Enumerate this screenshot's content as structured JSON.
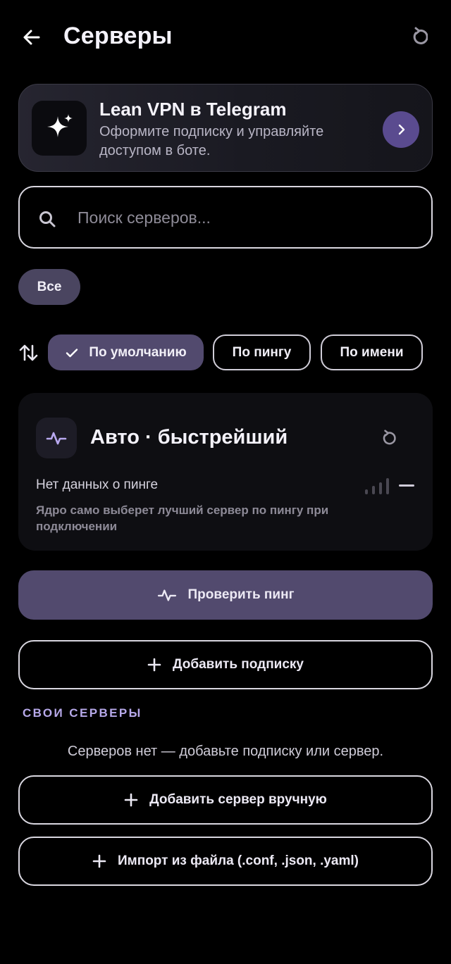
{
  "header": {
    "title": "Серверы",
    "back_icon": "arrow-left-icon",
    "refresh_icon": "refresh-icon"
  },
  "promo": {
    "title": "Lean VPN в Telegram",
    "subtitle": "Оформите подписку и управляйте доступом в боте.",
    "icon": "sparkle-icon",
    "arrow_icon": "chevron-right-icon",
    "accent_color": "#5a4b8f"
  },
  "search": {
    "placeholder": "Поиск серверов...",
    "value": ""
  },
  "filters": {
    "all_label": "Все"
  },
  "sort": {
    "options": [
      {
        "label": "По умолчанию",
        "selected": true
      },
      {
        "label": "По пингу",
        "selected": false
      },
      {
        "label": "По имени",
        "selected": false
      }
    ]
  },
  "auto": {
    "title": "Авто · быстрейший",
    "status": "Нет данных о пинге",
    "description": "Ядро само выберет лучший сервер по пингу при подключении",
    "ping_value": "—"
  },
  "actions": {
    "check_ping": "Проверить пинг",
    "add_subscription": "Добавить подписку",
    "add_manual": "Добавить сервер вручную",
    "import_file": "Импорт из файла (.conf, .json, .yaml)"
  },
  "own_servers": {
    "label": "СВОИ СЕРВЕРЫ",
    "empty": "Серверов нет — добавьте подписку или сервер."
  }
}
